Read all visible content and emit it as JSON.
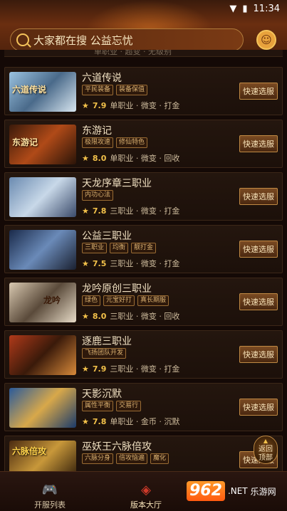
{
  "status_bar": {
    "time": "11:34",
    "wifi_icon": "wifi-icon",
    "battery_icon": "battery-icon"
  },
  "search": {
    "placeholder": "大家都在搜 公益忘忧"
  },
  "list_clipped_text": "单职业 · 超变 · 无级别",
  "games": [
    {
      "name": "六道传说",
      "tags": [
        "平民装备",
        "装备保值"
      ],
      "rating": "7.9",
      "meta": "单职业 · 微变 · 打金",
      "button": "快速选服",
      "thumb_text": "六道传说",
      "thumb_color": "#7aa6d0"
    },
    {
      "name": "东游记",
      "tags": [
        "极限攻速",
        "修仙特色"
      ],
      "rating": "8.0",
      "meta": "单职业 · 微变 · 回收",
      "button": "快速选服",
      "thumb_text": "东游记",
      "thumb_color": "#8a3a18"
    },
    {
      "name": "天龙序章三职业",
      "tags": [
        "内功心法"
      ],
      "rating": "7.8",
      "meta": "三职业 · 微变 · 打金",
      "button": "快速选服",
      "thumb_text": "",
      "thumb_color": "#4a6aa0"
    },
    {
      "name": "公益三职业",
      "tags": [
        "三职业",
        "均衡",
        "靓打金"
      ],
      "rating": "7.5",
      "meta": "三职业 · 微变 · 打金",
      "button": "快速选服",
      "thumb_text": "",
      "thumb_color": "#2a3a5a"
    },
    {
      "name": "龙吟原创三职业",
      "tags": [
        "绿色",
        "元宝好打",
        "真长期服"
      ],
      "rating": "8.0",
      "meta": "三职业 · 微变 · 回收",
      "button": "快速选服",
      "thumb_text": "龙吟",
      "thumb_color": "#6a5a4a"
    },
    {
      "name": "逐鹿三职业",
      "tags": [
        "飞扬团队开发"
      ],
      "rating": "7.9",
      "meta": "三职业 · 微变 · 打金",
      "button": "快速选服",
      "thumb_text": "",
      "thumb_color": "#8a2a1a"
    },
    {
      "name": "天影沉默",
      "tags": [
        "属性平衡",
        "交易行"
      ],
      "rating": "7.8",
      "meta": "单职业 · 金币 · 沉默",
      "button": "快速选服",
      "thumb_text": "",
      "thumb_color": "#3a6a9a"
    },
    {
      "name": "巫妖王六脉倍攻",
      "tags": [
        "六脉分身",
        "倍攻恼遍",
        "魔化"
      ],
      "rating": "",
      "meta": "",
      "button": "快速选服",
      "thumb_text": "六脉倍攻",
      "thumb_color": "#6a3a18"
    }
  ],
  "back_top": {
    "line1": "返回",
    "line2": "顶部"
  },
  "tabs": [
    {
      "label": "开服列表",
      "icon": "gamepad-icon"
    },
    {
      "label": "版本大厅",
      "icon": "layers-icon"
    }
  ],
  "watermark": {
    "logo": "962",
    "suffix": ".NET",
    "text": "乐游网"
  }
}
